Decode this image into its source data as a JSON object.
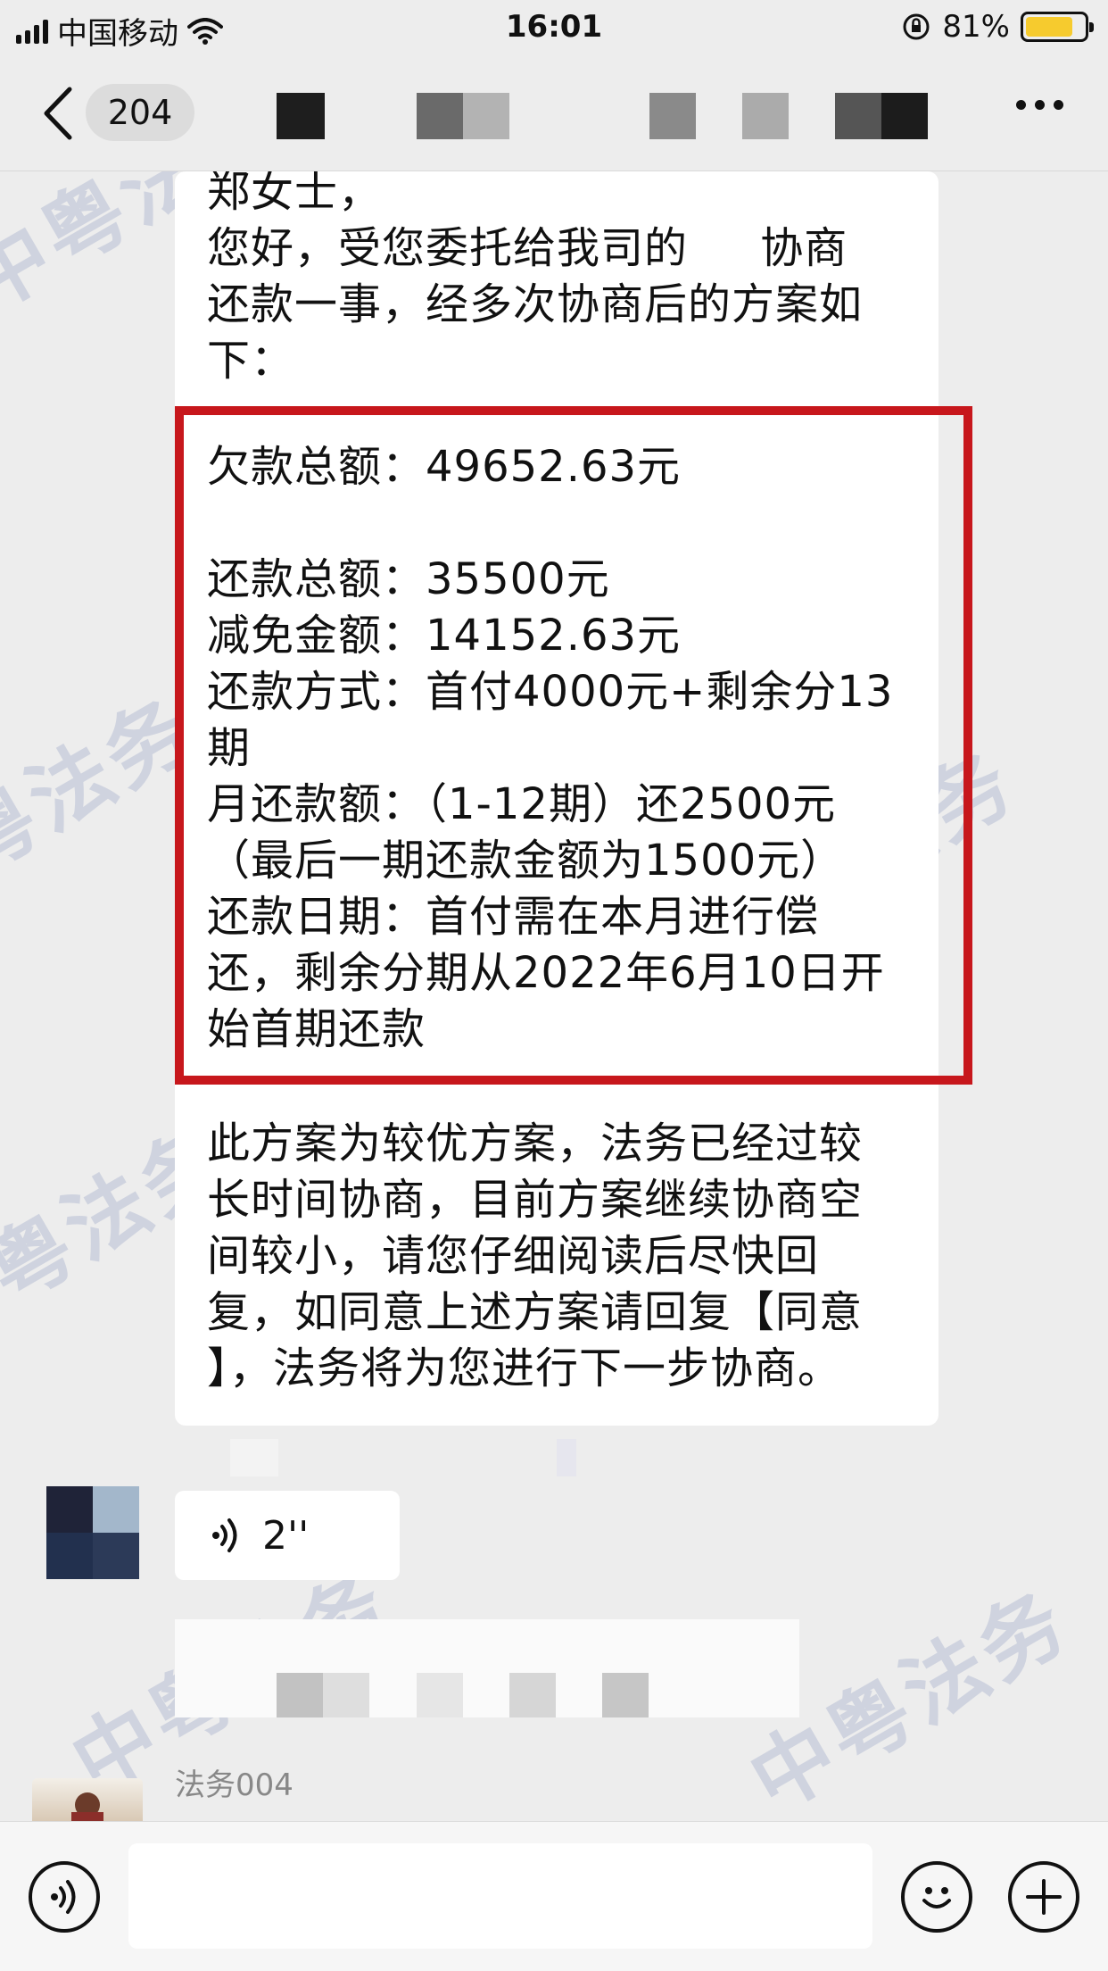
{
  "status_bar": {
    "carrier": "中国移动",
    "time": "16:01",
    "battery_percent": "81%",
    "battery_level": 0.81,
    "battery_color": "#f6cb2e"
  },
  "nav": {
    "unread_count": "204"
  },
  "message": {
    "intro_lines": [
      "郑女士，",
      "您好，受您委托给我司的     协商",
      "还款一事，经多次协商后的方案如",
      "下："
    ],
    "plan_lines": [
      "欠款总额：49652.63元",
      "",
      "还款总额：35500元",
      "减免金额：14152.63元",
      "还款方式：首付4000元+剩余分13",
      "期",
      "月还款额：（1-12期）还2500元",
      "（最后一期还款金额为1500元）",
      "还款日期：首付需在本月进行偿",
      "还，剩余分期从2022年6月10日开",
      "始首期还款"
    ],
    "outro_lines": [
      "此方案为较优方案，法务已经过较",
      "长时间协商，目前方案继续协商空",
      "间较小，请您仔细阅读后尽快回",
      "复，如同意上述方案请回复【同意",
      "】，法务将为您进行下一步协商。"
    ],
    "highlight_color": "#c7171c"
  },
  "voice_message": {
    "duration": "2''"
  },
  "next_sender": {
    "name": "法务004"
  },
  "watermark": {
    "text": "中粤法务"
  },
  "input_bar": {
    "icons": [
      "voice-icon",
      "emoji-icon",
      "plus-icon"
    ]
  }
}
